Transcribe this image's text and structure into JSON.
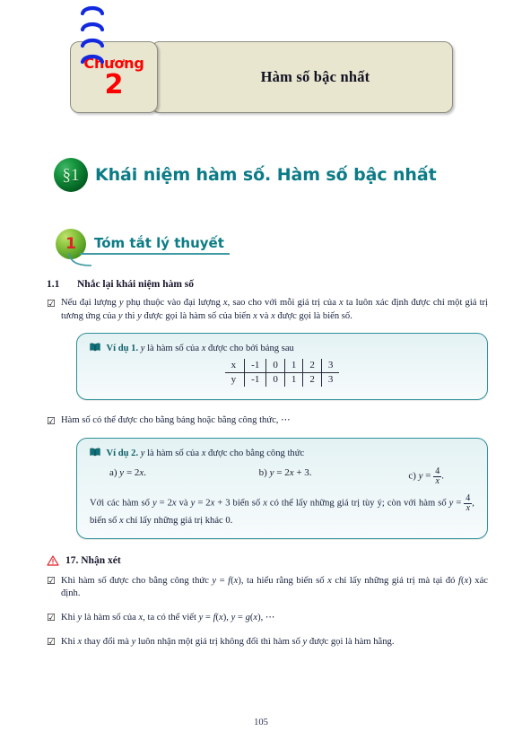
{
  "chapter": {
    "label": "Chương",
    "number": "2",
    "title": "Hàm số bậc nhất",
    "banner_bg": "#e8e6cf",
    "label_color": "#fe0000",
    "spiral_color": "#1229e0",
    "rings": 4
  },
  "section": {
    "badge": "§1",
    "title": "Khái niệm hàm số. Hàm số bậc nhất",
    "accent_color": "#0b7b86"
  },
  "part": {
    "number": "1",
    "title": "Tóm tắt lý thuyết",
    "number_color": "#e0202a",
    "accent_color": "#0b7b86"
  },
  "subsection": {
    "number": "1.1",
    "title": "Nhắc lại khái niệm hàm số"
  },
  "bullets": [
    {
      "icon": "checked-checkbox-icon",
      "html": "Nếu đại lượng <i>y</i> phụ thuộc vào đại lượng <i>x</i>, sao cho với mỗi giá trị của <i>x</i> ta luôn xác định được chỉ một giá trị tương ứng của <i>y</i> thì <i>y</i> được gọi là hàm số của biến <i>x</i> và <i>x</i> được gọi là biến số."
    },
    {
      "icon": "checked-checkbox-icon",
      "html": "Hàm số có thể được cho bằng bảng hoặc bằng công thức, ⋯"
    }
  ],
  "example1": {
    "icon": "book-icon",
    "label": "Ví dụ 1.",
    "statement_html": " <i>y</i> là hàm số của <i>x</i> được cho bởi bảng sau",
    "table": {
      "rows": [
        {
          "header": "x",
          "values": [
            "-1",
            "0",
            "1",
            "2",
            "3"
          ]
        },
        {
          "header": "y",
          "values": [
            "-1",
            "0",
            "1",
            "2",
            "3"
          ]
        }
      ]
    }
  },
  "example2": {
    "icon": "book-icon",
    "label": "Ví dụ 2.",
    "statement_html": " <i>y</i> là hàm số của <i>x</i> được cho bằng công thức",
    "items": [
      {
        "tag": "a)",
        "formula_html": "<i>y</i> = 2<i>x</i>."
      },
      {
        "tag": "b)",
        "formula_html": "<i>y</i> = 2<i>x</i> + 3."
      },
      {
        "tag": "c)",
        "formula_html": "<i>y</i> =",
        "fraction": {
          "numerator": "4",
          "denominator": "x"
        },
        "suffix": "."
      }
    ],
    "note_html": "Với các hàm số <i>y</i> = 2<i>x</i> và <i>y</i> = 2<i>x</i> + 3 biến số <i>x</i> có thể lấy những giá trị tùy ý; còn với hàm số <i>y</i> = ",
    "note_fraction": {
      "numerator": "4",
      "denominator": "x"
    },
    "note_tail_html": ", biến số <i>x</i> chỉ lấy những giá trị khác 0."
  },
  "notice": {
    "icon": "warning-triangle-icon",
    "number": "17.",
    "title": "Nhận xét",
    "icon_color": "#e01f26",
    "items": [
      {
        "icon": "checked-checkbox-icon",
        "html": "Khi hàm số được cho bằng công thức <i>y</i> = <i>f</i>(<i>x</i>), ta hiểu rằng biến số <i>x</i> chỉ lấy những giá trị mà tại đó <i>f</i>(<i>x</i>) xác định."
      },
      {
        "icon": "checked-checkbox-icon",
        "html": "Khi <i>y</i> là hàm số của <i>x</i>, ta có thể viết <i>y</i> = <i>f</i>(<i>x</i>), <i>y</i> = <i>g</i>(<i>x</i>), ⋯"
      },
      {
        "icon": "checked-checkbox-icon",
        "html": "Khi <i>x</i> thay đổi mà <i>y</i> luôn nhận một giá trị không đổi thì hàm số <i>y</i> được gọi là hàm hằng."
      }
    ]
  },
  "footer": {
    "page_number": "105"
  },
  "glyphs": {
    "checkbox_checked": "☑"
  }
}
